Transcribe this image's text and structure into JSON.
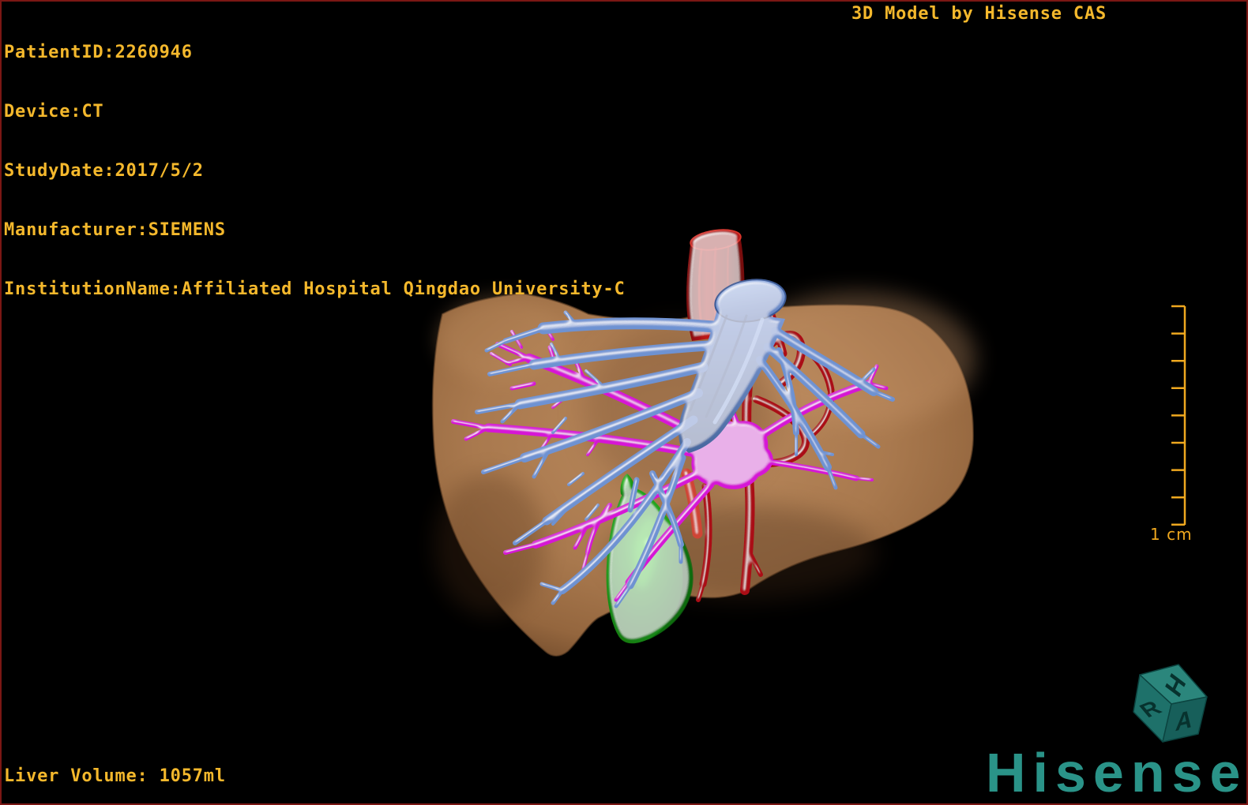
{
  "header": {
    "patient_lines": [
      "PatientID:2260946",
      "Device:CT",
      "StudyDate:2017/5/2",
      "Manufacturer:SIEMENS",
      "InstitutionName:Affiliated Hospital Qingdao University-C"
    ],
    "title_right": "3D Model by Hisense CAS"
  },
  "footer": {
    "liver_volume": "Liver Volume: 1057ml"
  },
  "scale_bar": {
    "label": "1 cm",
    "tick_count": 9,
    "interval_cm": 1
  },
  "logo": {
    "brand": "Hisense",
    "cube_letters": [
      "H",
      "R",
      "A"
    ]
  },
  "model": {
    "structures": [
      {
        "name": "liver",
        "color": "#a9794e"
      },
      {
        "name": "hepatic-veins",
        "color": "#6e92d2"
      },
      {
        "name": "portal-vein",
        "color": "#d618d6"
      },
      {
        "name": "ivc-and-artery",
        "color": "#aa1013"
      },
      {
        "name": "gallbladder",
        "color": "#1f9c17"
      }
    ]
  },
  "colors": {
    "gold": "#f4b82c",
    "scale_gold": "#efa81f",
    "border_red": "#7b1714",
    "teal": "#2a9388",
    "teal_top": "#2b867c",
    "teal_left": "#1e716a",
    "teal_right": "#175f5a",
    "cube_letter": "#07322e",
    "liver": "#a9794e",
    "liver_hi": "#bb8a5e",
    "liver_dk": "#6b4628",
    "blue": "#6e92d2",
    "blue_hi": "#a9bfec",
    "blue_dk": "#3a589c",
    "magenta": "#d618d6",
    "magenta_hi": "#f25cf2",
    "magenta_dk": "#8e0d92",
    "red": "#aa1013",
    "red_hi": "#cf4434",
    "red_dk": "#650808",
    "green": "#1f9c17",
    "green_hi": "#49cf35",
    "green_dk": "#0b5e0e"
  }
}
